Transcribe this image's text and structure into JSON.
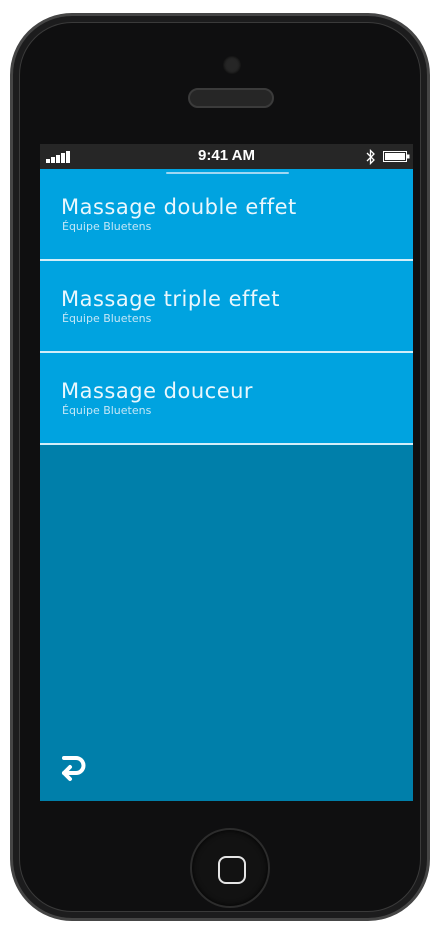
{
  "status_bar": {
    "time": "9:41 AM",
    "signal_icon": "signal-bars-icon",
    "bluetooth_icon": "bluetooth-icon",
    "battery_icon": "battery-icon"
  },
  "list": {
    "items": [
      {
        "title": "Massage double effet",
        "subtitle": "Équipe Bluetens"
      },
      {
        "title": "Massage triple effet",
        "subtitle": "Équipe Bluetens"
      },
      {
        "title": "Massage douceur",
        "subtitle": "Équipe Bluetens"
      }
    ]
  },
  "navigation": {
    "back_icon": "return-arrow-icon"
  },
  "colors": {
    "item_background": "#00a3e0",
    "screen_background": "#007faa",
    "status_bar": "#262626",
    "phone_body": "#0f0f10"
  }
}
